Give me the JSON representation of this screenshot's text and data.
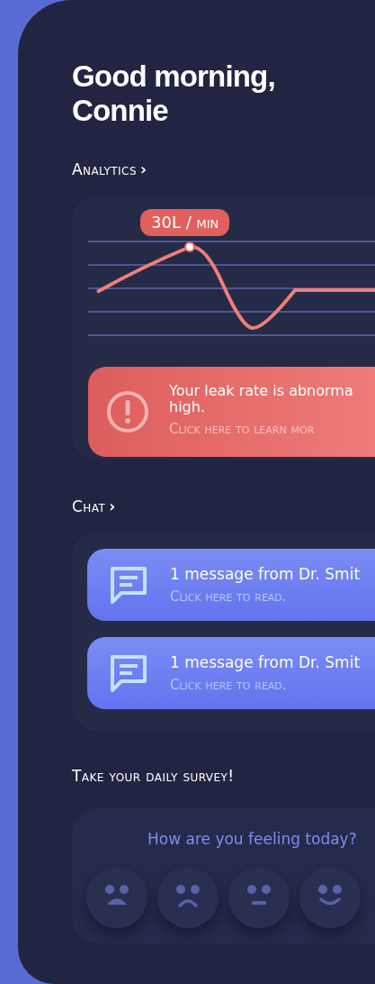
{
  "greeting": "Good morning, Connie",
  "analytics": {
    "heading": "Analytics",
    "chevron": "›",
    "tooltip": "30L / min",
    "alert": {
      "message": "Your leak rate is abnorma high.",
      "link": "Click here to learn mor"
    }
  },
  "chat": {
    "heading": "Chat",
    "chevron": "›",
    "messages": [
      {
        "title": "1 message from Dr. Smit",
        "link": "Click here to read."
      },
      {
        "title": "1 message from Dr. Smit",
        "link": "Click here to read."
      }
    ]
  },
  "survey": {
    "heading": "Take your daily survey!",
    "question": "How are you feeling today?",
    "faces": [
      {
        "kind": "upset"
      },
      {
        "kind": "sad"
      },
      {
        "kind": "neutral"
      },
      {
        "kind": "happy"
      }
    ]
  }
}
